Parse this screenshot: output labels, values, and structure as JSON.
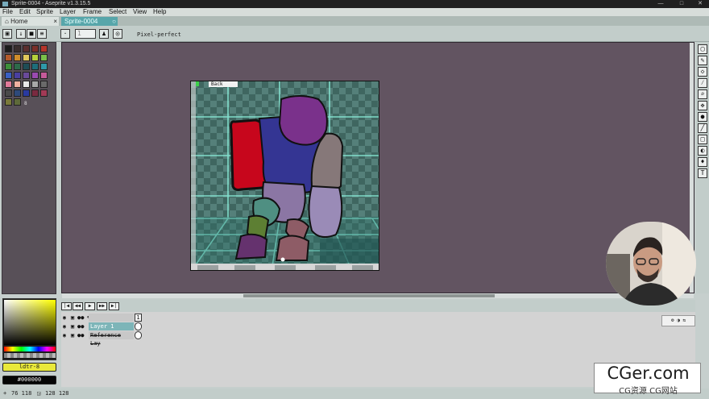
{
  "window": {
    "title": "Sprite-0004 - Aseprite v1.3.15.5"
  },
  "menu": [
    "File",
    "Edit",
    "Sprite",
    "Layer",
    "Frame",
    "Select",
    "View",
    "Help"
  ],
  "tabs": [
    {
      "label": "Home",
      "close": "×"
    },
    {
      "label": "Sprite-0004",
      "close": "○"
    }
  ],
  "context_bar": {
    "brush_size": "1",
    "mode_label": "Pixel-perfect"
  },
  "palette": {
    "colors": [
      "#1b1b1b",
      "#3a2e2e",
      "#5b2f2f",
      "#7a2f2a",
      "#b5342b",
      "#b35a2b",
      "#cf8d2b",
      "#dfc75b",
      "#b6d13b",
      "#7ac04a",
      "#3d8f3a",
      "#2d6a4a",
      "#1f4d56",
      "#1e6e7a",
      "#2f99a9",
      "#3a5fc4",
      "#4a3fa0",
      "#6a4a9a",
      "#9a4ab0",
      "#c55a9a",
      "#e07a9a",
      "#f0b0a0",
      "#e8e8e8",
      "#a8a8a8",
      "#6a6a6a",
      "#4a4a4a",
      "#2e4a7a",
      "#2a3aa0",
      "#7a2a40",
      "#a23a56",
      "#7a7a3a",
      "#5e6a3a"
    ],
    "index_label": "8"
  },
  "sprite": {
    "layer_hint": "Back",
    "shape_colors": {
      "red": "#c7061c",
      "blue": "#343593",
      "purple": "#7a318b",
      "lavender": "#8b76a4",
      "gray": "#867879",
      "teal": "#4f8f82",
      "olive": "#5d7f33",
      "violet": "#65326e",
      "mauve": "#8e5c66",
      "light_lavender": "#9a8bb7",
      "bg": "#466e66",
      "grid": "#8bf0dc"
    }
  },
  "color_picker": {
    "foreground": "ldtr-8",
    "background": "#000000"
  },
  "timeline": {
    "layers": [
      {
        "name": "",
        "visible_icon": "eye-icon"
      },
      {
        "name": "Layer 1",
        "visible_icon": "eye-icon"
      },
      {
        "name": "Reference Lay",
        "visible_icon": "eye-icon"
      }
    ],
    "frame_number": "1"
  },
  "status": {
    "pos": "76 118",
    "size": "128 128"
  },
  "watermark": {
    "main": "CGer.com",
    "sub": "CG资源  CG网站"
  },
  "colors": {
    "accent_tab": "#57a6aa",
    "canvas_bg": "#625461",
    "panel_bg": "#585058"
  }
}
